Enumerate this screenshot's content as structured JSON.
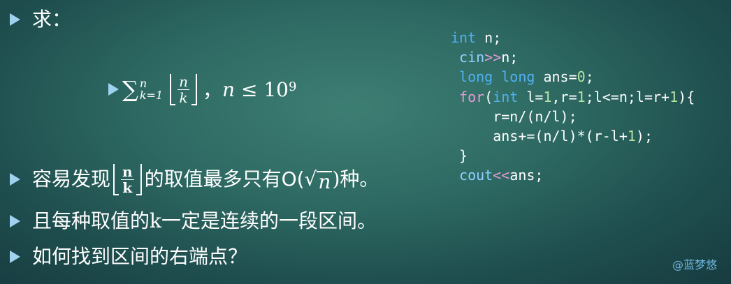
{
  "bullets": {
    "b1": "求：",
    "b3_pre": "容易发现",
    "b3_post": "的取值最多只有",
    "b3_big_o": "O(",
    "b3_close": ")种。",
    "b4": "且每种取值的k一定是连续的一段区间。",
    "b5": "如何找到区间的右端点？"
  },
  "formula": {
    "sigma": "∑",
    "upper": "n",
    "lower": "k=1",
    "frac_num": "n",
    "frac_den": "k",
    "sep": "，",
    "cond_var": "n",
    "cond_op": " ≤ ",
    "cond_base": "10",
    "cond_exp": "9"
  },
  "inline_frac": {
    "num": "n",
    "den": "k"
  },
  "sqrt_var": "n",
  "code_lines": [
    "int n;",
    " cin>>n;",
    " long long ans=0;",
    " for(int l=1,r=1;l<=n;l=r+1){",
    "     r=n/(n/l);",
    "     ans+=(n/l)*(r-l+1);",
    " }",
    " cout<<ans;"
  ],
  "watermark": "@蓝梦悠",
  "colors": {
    "bullet": "#9fd2ee",
    "keyword": "#52b0f0",
    "keyword_for": "#e59bd8",
    "number": "#b6e3a1"
  }
}
